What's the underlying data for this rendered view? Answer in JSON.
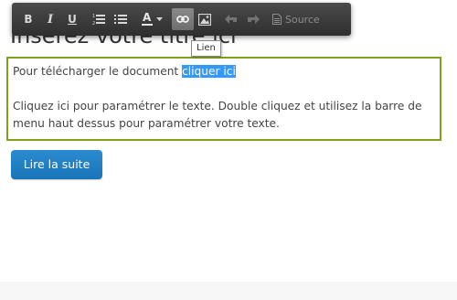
{
  "heading": {
    "title": "Insérez votre titre ici"
  },
  "editor": {
    "line1_prefix": "Pour télécharger le document ",
    "line1_link": "cliquer ici",
    "paragraph2": "Cliquez ici pour paramétrer le texte. Double cliquez et utilisez la barre de menu haut dessus pour paramétrer votre texte."
  },
  "read_more": {
    "label": "Lire la suite"
  },
  "toolbar": {
    "bold_label": "B",
    "italic_label": "I",
    "underline_label": "U",
    "font_color_label": "A",
    "source_label": "Source",
    "buttons": [
      {
        "icon": "bold-icon"
      },
      {
        "icon": "italic-icon"
      },
      {
        "icon": "underline-icon"
      },
      {
        "icon": "numbered-list-icon"
      },
      {
        "icon": "bulleted-list-icon"
      },
      {
        "icon": "text-color-icon"
      },
      {
        "icon": "link-icon",
        "state": "active"
      },
      {
        "icon": "image-icon"
      },
      {
        "icon": "undo-icon",
        "state": "disabled"
      },
      {
        "icon": "redo-icon",
        "state": "disabled"
      },
      {
        "icon": "source-icon",
        "state": "disabled"
      }
    ]
  },
  "tooltip": {
    "text": "Lien"
  },
  "colors": {
    "editor_border": "#7fa11d",
    "button_blue": "#1f7fc4",
    "selection": "#3399ff",
    "toolbar_bg": "#3a3a3a"
  }
}
